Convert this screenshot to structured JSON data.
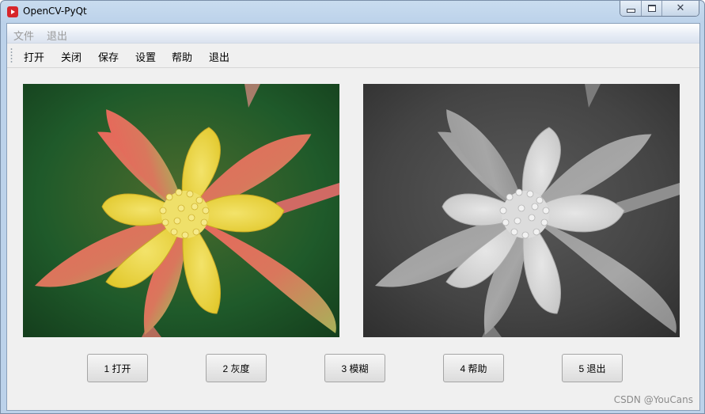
{
  "window": {
    "title": "OpenCV-PyQt",
    "colors": {
      "icon": "#d7262b",
      "title_bar": "#bcd2ea"
    }
  },
  "menubar": {
    "items": [
      {
        "label": "文件"
      },
      {
        "label": "退出"
      }
    ]
  },
  "toolbar": {
    "items": [
      {
        "label": "打开"
      },
      {
        "label": "关闭"
      },
      {
        "label": "保存"
      },
      {
        "label": "设置"
      },
      {
        "label": "帮助"
      },
      {
        "label": "退出"
      }
    ]
  },
  "images": {
    "left": {
      "name": "original-image"
    },
    "right": {
      "name": "grayscale-image"
    }
  },
  "buttons": [
    {
      "label": "1 打开"
    },
    {
      "label": "2 灰度"
    },
    {
      "label": "3 模糊"
    },
    {
      "label": "4 帮助"
    },
    {
      "label": "5 退出"
    }
  ],
  "watermark": "CSDN @YouCans"
}
